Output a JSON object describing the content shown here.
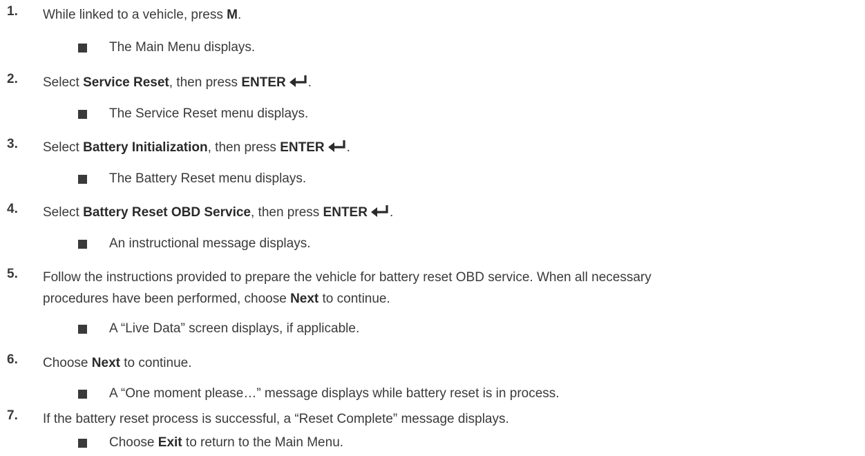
{
  "steps": [
    {
      "num": "1.",
      "parts": [
        "While linked to a vehicle, press ",
        "M",
        "."
      ]
    },
    {
      "num": "2.",
      "parts": [
        "Select ",
        "Service Reset",
        ", then press ",
        "ENTER",
        "."
      ]
    },
    {
      "num": "3.",
      "parts": [
        "Select ",
        "Battery Initialization",
        ", then press ",
        "ENTER",
        "."
      ]
    },
    {
      "num": "4.",
      "parts": [
        "Select ",
        "Battery Reset OBD Service",
        ", then press ",
        "ENTER",
        "."
      ]
    },
    {
      "num": "5.",
      "line1": "Follow the instructions provided to prepare the vehicle for battery reset OBD service. When all necessary",
      "parts": [
        "procedures have been performed, choose ",
        "Next",
        " to continue."
      ]
    },
    {
      "num": "6.",
      "parts": [
        "Choose ",
        "Next",
        " to continue."
      ]
    },
    {
      "num": "7.",
      "text": "If the battery reset process is successful, a “Reset Complete” message displays."
    }
  ],
  "bullets": [
    "The Main Menu displays.",
    "The Service Reset menu displays.",
    "The Battery Reset menu displays.",
    "An instructional message displays.",
    "A “Live Data” screen displays, if applicable.",
    "A “One moment please…” message displays while battery reset is in process."
  ],
  "bullet7": [
    "Choose ",
    "Exit",
    " to return to the Main Menu."
  ],
  "icons": {
    "enter": "enter-return-arrow-icon",
    "bullet": "square-bullet-icon"
  }
}
